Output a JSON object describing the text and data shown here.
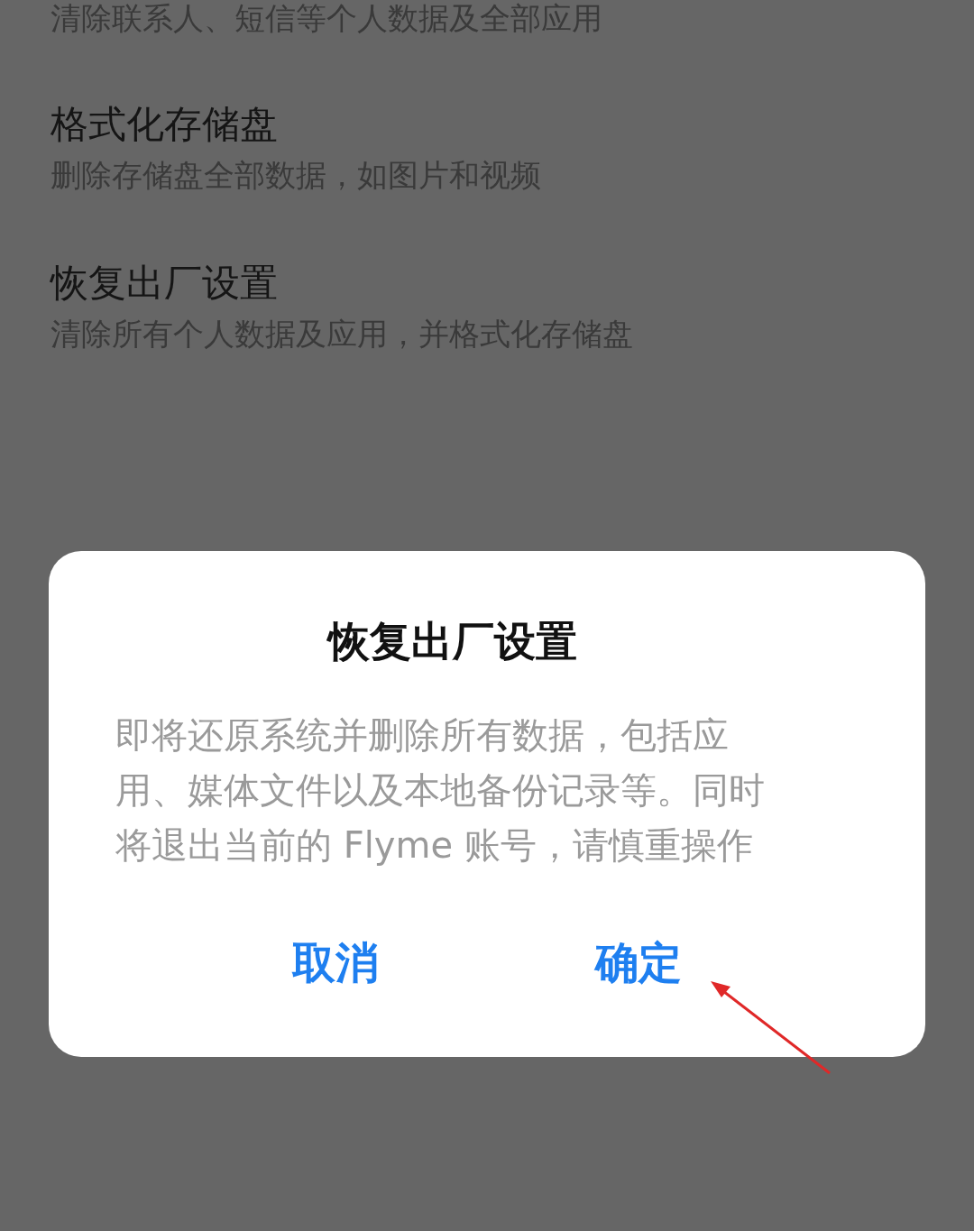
{
  "settings": {
    "top_partial_subtitle": "清除联系人、短信等个人数据及全部应用",
    "items": [
      {
        "title": "格式化存储盘",
        "subtitle": "删除存储盘全部数据，如图片和视频"
      },
      {
        "title": "恢复出厂设置",
        "subtitle": "清除所有个人数据及应用，并格式化存储盘"
      }
    ]
  },
  "dialog": {
    "title": "恢复出厂设置",
    "message": "即将还原系统并删除所有数据，包括应用、媒体文件以及本地备份记录等。同时将退出当前的 Flyme 账号，请慎重操作",
    "buttons": [
      "取消",
      "确定"
    ]
  }
}
